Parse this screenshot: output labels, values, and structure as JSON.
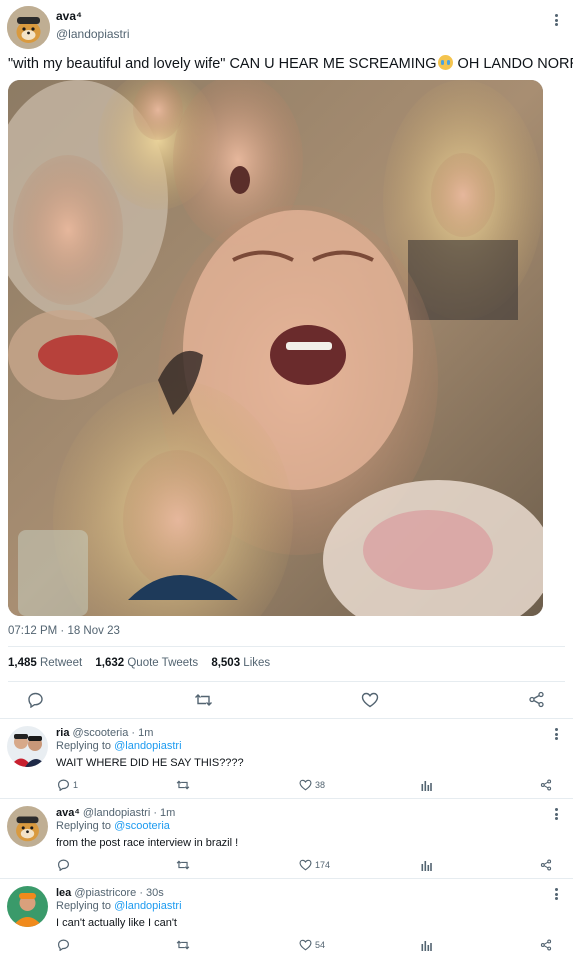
{
  "main_tweet": {
    "display_name": "ava⁴",
    "handle": "@landopiastri",
    "text_before_emoji": "\"with my beautiful and lovely wife\" CAN U HEAR ME SCREAMING",
    "emoji": "loudly-crying-face",
    "text_after_emoji": " OH LANDO NORRIS",
    "timestamp": "07:12 PM · 18 Nov 23",
    "stats": {
      "retweets_count": "1,485",
      "retweets_label": "Retweet",
      "quotes_count": "1,632",
      "quotes_label": "Quote Tweets",
      "likes_count": "8,503",
      "likes_label": "Likes"
    }
  },
  "replies": [
    {
      "display_name": "ria",
      "handle_time": "@scooteria · 1m",
      "replying_prefix": "Replying to ",
      "replying_to": "@landopiastri",
      "text": "WAIT WHERE DID HE SAY THIS????",
      "reply_count": "1",
      "retweet_count": "",
      "like_count": "38"
    },
    {
      "display_name": "ava⁴",
      "handle_time": "@landopiastri · 1m",
      "replying_prefix": "Replying to ",
      "replying_to": "@scooteria",
      "text": "from the post race interview in brazil !",
      "reply_count": "",
      "retweet_count": "",
      "like_count": "174"
    },
    {
      "display_name": "lea",
      "handle_time": "@piastricore · 30s",
      "replying_prefix": "Replying to ",
      "replying_to": "@landopiastri",
      "text": "I can't actually like I can't",
      "reply_count": "",
      "retweet_count": "",
      "like_count": "54"
    }
  ],
  "colors": {
    "text": "#0f1419",
    "secondary": "#536471",
    "link": "#1d9bf0",
    "divider": "#e6ecf0"
  }
}
